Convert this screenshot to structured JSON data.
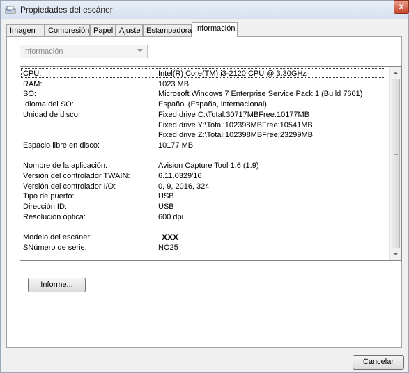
{
  "window": {
    "title": "Propiedades del escáner",
    "close_label": "x"
  },
  "tabs": [
    {
      "label": "Imagen"
    },
    {
      "label": "Compresión"
    },
    {
      "label": "Papel"
    },
    {
      "label": "Ajuste"
    },
    {
      "label": "Estampadora"
    },
    {
      "label": "Información"
    }
  ],
  "active_tab": "Información",
  "dropdown": {
    "selected": "Información"
  },
  "info_rows": [
    {
      "key": "CPU:",
      "value": "Intel(R) Core(TM) i3-2120 CPU @ 3.30GHz"
    },
    {
      "key": "RAM:",
      "value": "1023 MB"
    },
    {
      "key": "SO:",
      "value": "Microsoft Windows 7 Enterprise Service Pack 1 (Build 7601)"
    },
    {
      "key": "Idioma del SO:",
      "value": "Español (España, internacional)"
    },
    {
      "key": "Unidad de disco:",
      "value": "Fixed drive C:\\Total:30717MBFree:10177MB"
    },
    {
      "key": "",
      "value": "Fixed drive Y:\\Total:102398MBFree:10541MB"
    },
    {
      "key": "",
      "value": "Fixed drive Z:\\Total:102398MBFree:23299MB"
    },
    {
      "key": "Espacio libre en disco:",
      "value": "10177 MB"
    },
    {
      "key": "",
      "value": ""
    },
    {
      "key": "Nombre de la aplicación:",
      "value": "Avision Capture Tool 1.6 (1.9)"
    },
    {
      "key": "Versión del controlador TWAIN:",
      "value": "6.11.0329'16"
    },
    {
      "key": "Versión del controlador I/O:",
      "value": "0, 9, 2016, 324"
    },
    {
      "key": "Tipo de puerto:",
      "value": "USB"
    },
    {
      "key": "Dirección ID:",
      "value": "USB"
    },
    {
      "key": "Resolución óptica:",
      "value": "600 dpi"
    },
    {
      "key": "",
      "value": ""
    },
    {
      "key": "Modelo del escáner:",
      "value": "XXX"
    },
    {
      "key": "SNúmero de serie:",
      "value": "NO25"
    }
  ],
  "buttons": {
    "report": "Informe...",
    "cancel": "Cancelar"
  }
}
